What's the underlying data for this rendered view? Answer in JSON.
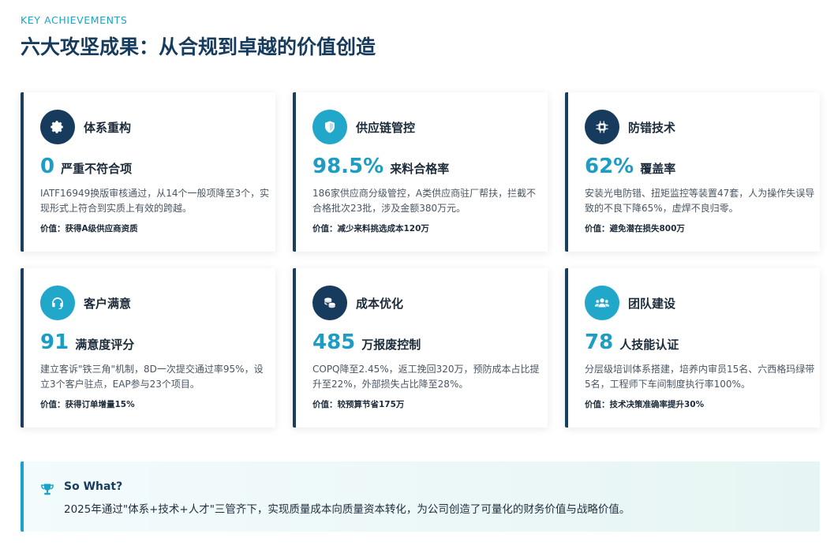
{
  "header": {
    "eyebrow": "KEY ACHIEVEMENTS",
    "title": "六大攻坚成果：从合规到卓越的价值创造"
  },
  "cards": [
    {
      "icon": "gear-icon",
      "title": "体系重构",
      "metric_value": "0",
      "metric_unit": "严重不符合项",
      "desc": "IATF16949换版审核通过，从14个一般项降至3个，实现形式上符合到实质上有效的跨越。",
      "value_line": "价值：获得A级供应商资质"
    },
    {
      "icon": "shield-icon",
      "title": "供应链管控",
      "metric_value": "98.5%",
      "metric_unit": "来料合格率",
      "desc": "186家供应商分级管控，A类供应商驻厂帮扶，拦截不合格批次23批，涉及金额380万元。",
      "value_line": "价值：减少来料挑选成本120万"
    },
    {
      "icon": "chip-icon",
      "title": "防错技术",
      "metric_value": "62%",
      "metric_unit": "覆盖率",
      "desc": "安装光电防错、扭矩监控等装置47套，人为操作失误导致的不良下降65%，虚焊不良归零。",
      "value_line": "价值：避免潜在损失800万"
    },
    {
      "icon": "headset-icon",
      "title": "客户满意",
      "metric_value": "91",
      "metric_unit": "满意度评分",
      "desc": "建立客诉\"铁三角\"机制，8D一次提交通过率95%，设立3个客户驻点，EAP参与23个项目。",
      "value_line": "价值：获得订单增量15%"
    },
    {
      "icon": "coins-icon",
      "title": "成本优化",
      "metric_value": "485",
      "metric_unit": "万报废控制",
      "desc": "COPQ降至2.45%，返工挽回320万，预防成本占比提升至22%，外部损失占比降至28%。",
      "value_line": "价值：较预算节省175万"
    },
    {
      "icon": "team-icon",
      "title": "团队建设",
      "metric_value": "78",
      "metric_unit": "人技能认证",
      "desc": "分层级培训体系搭建，培养内审员15名、六西格玛绿带5名，工程师下车间制度执行率100%。",
      "value_line": "价值：技术决策准确率提升30%"
    }
  ],
  "so_what": {
    "icon": "trophy-icon",
    "title": "So What?",
    "text": "2025年通过\"体系+技术+人才\"三管齐下，实现质量成本向质量资本转化，为公司创造了可量化的财务价值与战略价值。"
  },
  "colors": {
    "dark_navy": "#173b5c",
    "teal": "#20a7c9",
    "metric": "#1e9dc4"
  }
}
